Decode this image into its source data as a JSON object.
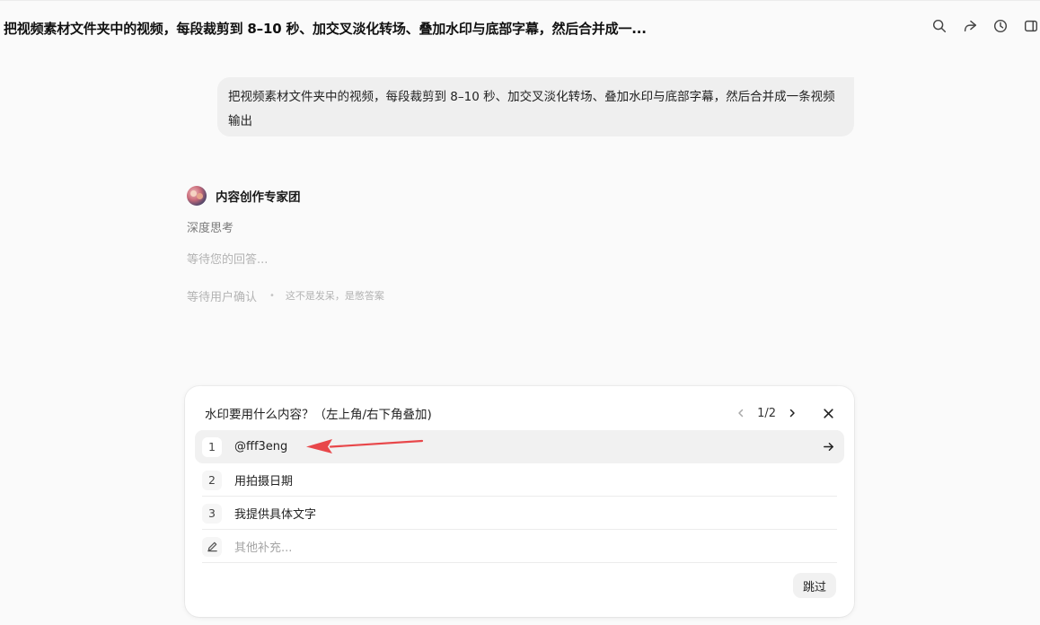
{
  "header": {
    "title": "把视频素材文件夹中的视频，每段裁剪到 8–10 秒、加交叉淡化转场、叠加水印与底部字幕，然后合并成一...",
    "icons": [
      "search-icon",
      "share-icon",
      "history-icon",
      "sidebar-toggle-icon"
    ]
  },
  "conversation": {
    "user_message": "把视频素材文件夹中的视频，每段裁剪到 8–10 秒、加交叉淡化转场、叠加水印与底部字幕，然后合并成一条视频输出",
    "assistant": {
      "name": "内容创作专家团",
      "deep_think_label": "深度思考",
      "waiting_text": "等待您的回答...",
      "confirm_status": "等待用户确认",
      "confirm_note": "这不是发呆，是憋答案"
    }
  },
  "question_card": {
    "title": "水印要用什么内容？（左上角/右下角叠加)",
    "page_indicator": "1/2",
    "options": [
      {
        "number": "1",
        "label": "@fff3eng"
      },
      {
        "number": "2",
        "label": "用拍摄日期"
      },
      {
        "number": "3",
        "label": "我提供具体文字"
      }
    ],
    "other_placeholder": "其他补充...",
    "skip_label": "跳过"
  },
  "colors": {
    "background": "#fafafa",
    "annotation_arrow": "#e8474a",
    "card_background": "#ffffff",
    "active_option": "#f1f1f1"
  }
}
